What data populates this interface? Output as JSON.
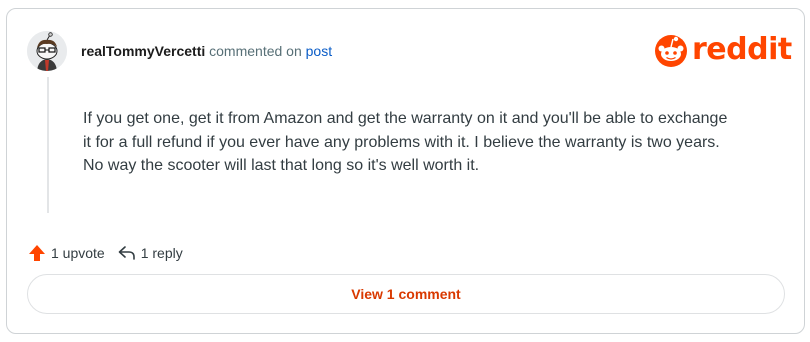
{
  "comment": {
    "username": "realTommyVercetti",
    "action_text": "commented on",
    "post_link": "post",
    "body": "If you get one, get it from Amazon and get the warranty on it and you'll be able to exchange it for a full refund if you ever have any problems with it. I believe the warranty is two years. No way the scooter will last that long so it's well worth it.",
    "upvote_label": "1 upvote",
    "reply_label": "1 reply",
    "view_comments_label": "View 1 comment"
  },
  "brand": {
    "wordmark": "reddit",
    "color": "#ff4500"
  },
  "icons": {
    "avatar": "snoo-avatar-icon",
    "logo": "reddit-snoo-icon",
    "upvote": "upvote-arrow-icon",
    "reply": "reply-arrow-icon"
  }
}
